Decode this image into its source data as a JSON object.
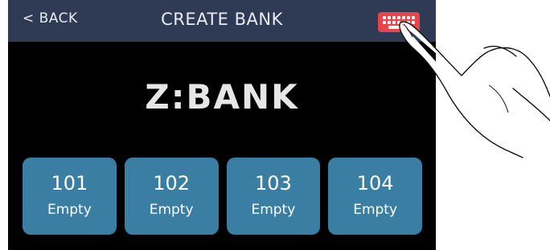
{
  "header": {
    "back_label": "< BACK",
    "title": "CREATE BANK",
    "keyboard_icon": "keyboard-icon"
  },
  "main": {
    "bank_name": "Z:BANK"
  },
  "slots": [
    {
      "number": "101",
      "state": "Empty"
    },
    {
      "number": "102",
      "state": "Empty"
    },
    {
      "number": "103",
      "state": "Empty"
    },
    {
      "number": "104",
      "state": "Empty"
    }
  ],
  "colors": {
    "header_bg": "#2f3a55",
    "screen_bg": "#000000",
    "slot_bg": "#3b7ea3",
    "keyboard_button": "#e8454a"
  }
}
